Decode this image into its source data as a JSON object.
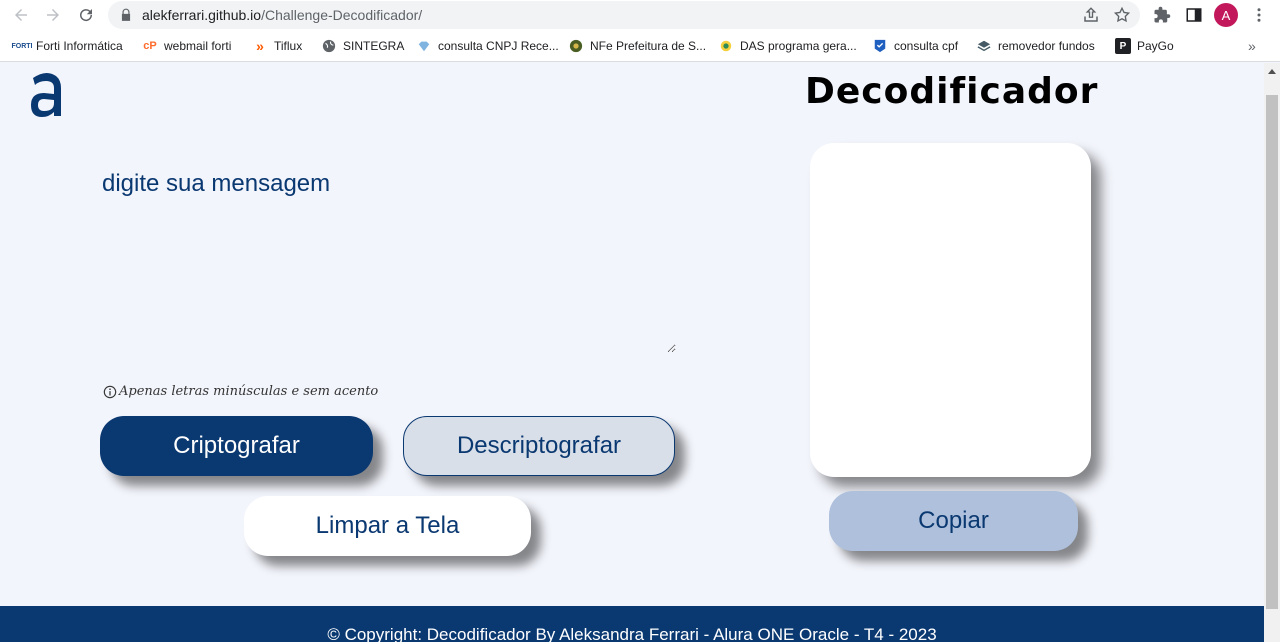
{
  "browser": {
    "url_host": "alekferrari.github.io",
    "url_path": "/Challenge-Decodificador/",
    "profile_initial": "A",
    "bookmarks": [
      {
        "label": "Forti Informática",
        "icon": "forti-icon"
      },
      {
        "label": "webmail forti",
        "icon": "cpanel-icon"
      },
      {
        "label": "Tiflux",
        "icon": "tiflux-icon"
      },
      {
        "label": "SINTEGRA",
        "icon": "globe-icon"
      },
      {
        "label": "consulta CNPJ Rece...",
        "icon": "diamond-icon"
      },
      {
        "label": "NFe Prefeitura de S...",
        "icon": "seal-icon"
      },
      {
        "label": "DAS programa gera...",
        "icon": "simples-icon"
      },
      {
        "label": "consulta cpf",
        "icon": "shield-icon"
      },
      {
        "label": "removedor fundos",
        "icon": "layers-icon"
      },
      {
        "label": "PayGo",
        "icon": "paygo-icon"
      }
    ],
    "more_bookmarks": "»"
  },
  "page": {
    "title": "Decodificador",
    "input_placeholder": "digite sua mensagem",
    "hint": "Apenas letras minúsculas e sem acento",
    "encrypt_label": "Criptografar",
    "decrypt_label": "Descriptografar",
    "clear_label": "Limpar a Tela",
    "copy_label": "Copiar",
    "output_value": "",
    "footer": "© Copyright: Decodificador By Aleksandra Ferrari - Alura ONE Oracle - T4 - 2023"
  },
  "colors": {
    "brand": "#0a3871",
    "background": "#f3f5fc",
    "copy_button": "#aec0db",
    "decrypt_button": "#d8dfe8"
  }
}
